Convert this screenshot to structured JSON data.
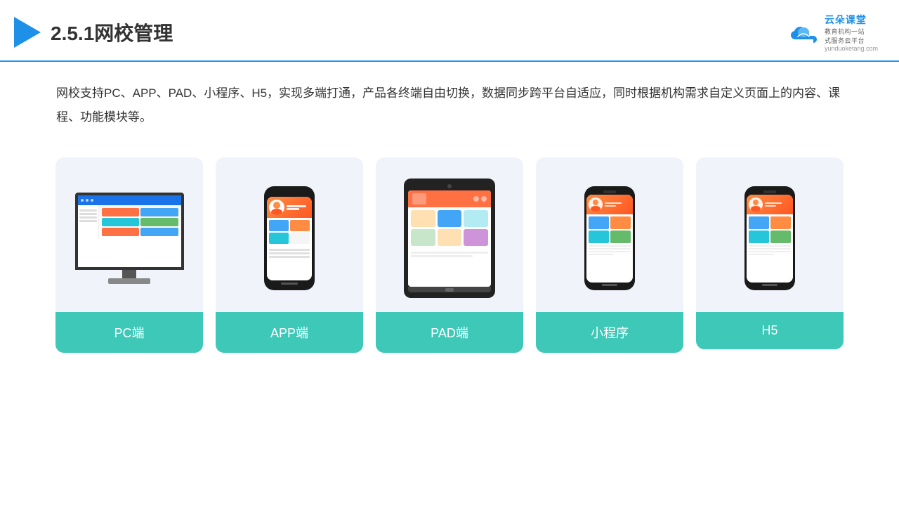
{
  "header": {
    "title": "2.5.1网校管理",
    "brand": {
      "name": "云朵课堂",
      "sub1": "教育机构一站",
      "sub2": "式服务云平台",
      "url": "yunduoketang.com"
    }
  },
  "description": {
    "text": "网校支持PC、APP、PAD、小程序、H5，实现多端打通，产品各终端自由切换，数据同步跨平台自适应，同时根据机构需求自定义页面上的内容、课程、功能模块等。"
  },
  "cards": [
    {
      "id": "pc",
      "label": "PC端"
    },
    {
      "id": "app",
      "label": "APP端"
    },
    {
      "id": "pad",
      "label": "PAD端"
    },
    {
      "id": "miniprogram",
      "label": "小程序"
    },
    {
      "id": "h5",
      "label": "H5"
    }
  ],
  "colors": {
    "accent": "#3dc8b8",
    "header_line": "#2196f3",
    "title": "#333333",
    "text": "#333333",
    "brand_blue": "#1e90e8"
  }
}
